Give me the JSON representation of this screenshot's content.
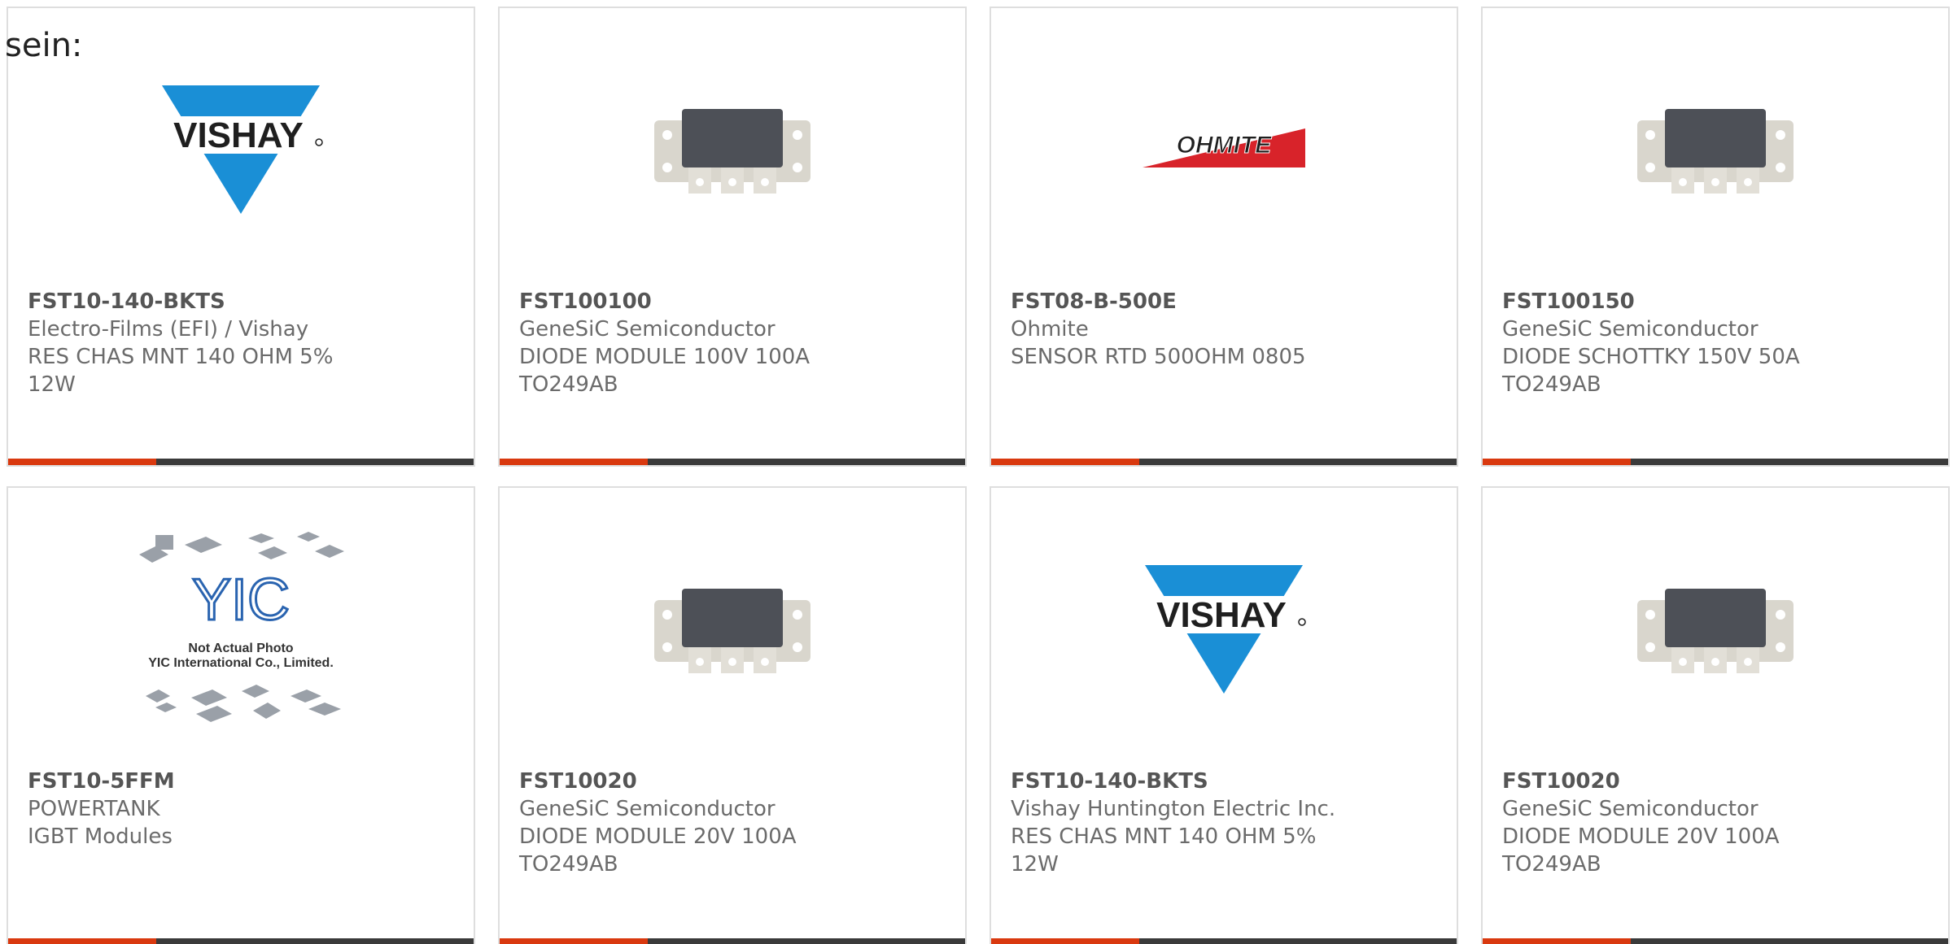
{
  "prefix_text": "sein:",
  "cards": [
    {
      "image": "vishay-logo",
      "part": "FST10-140-BKTS",
      "manufacturer": "Electro-Films (EFI) / Vishay",
      "description": "RES CHAS MNT 140 OHM 5% 12W"
    },
    {
      "image": "diode-module-photo",
      "part": "FST100100",
      "manufacturer": "GeneSiC Semiconductor",
      "description": "DIODE MODULE 100V 100A TO249AB"
    },
    {
      "image": "ohmite-logo",
      "part": "FST08-B-500E",
      "manufacturer": "Ohmite",
      "description": "SENSOR RTD 500OHM 0805"
    },
    {
      "image": "diode-module-photo",
      "part": "FST100150",
      "manufacturer": "GeneSiC Semiconductor",
      "description": "DIODE SCHOTTKY 150V 50A TO249AB"
    },
    {
      "image": "yic-placeholder",
      "part": "FST10-5FFM",
      "manufacturer": "POWERTANK",
      "description": "IGBT Modules",
      "image_caption_1": "Not Actual Photo",
      "image_caption_2": "YIC International Co., Limited.",
      "image_logo_text": "YIC"
    },
    {
      "image": "diode-module-photo",
      "part": "FST10020",
      "manufacturer": "GeneSiC Semiconductor",
      "description": "DIODE MODULE 20V 100A TO249AB"
    },
    {
      "image": "vishay-logo",
      "part": "FST10-140-BKTS",
      "manufacturer": "Vishay Huntington Electric Inc.",
      "description": "RES CHAS MNT 140 OHM 5% 12W"
    },
    {
      "image": "diode-module-photo",
      "part": "FST10020",
      "manufacturer": "GeneSiC Semiconductor",
      "description": "DIODE MODULE 20V 100A TO249AB"
    }
  ],
  "logos": {
    "vishay": "VISHAY",
    "ohmite": "OHMITE"
  },
  "colors": {
    "accent": "#d9390f",
    "bar": "#3a3a3a",
    "vishay_blue": "#1a8fd6",
    "ohmite_red": "#d8232a",
    "text": "#6b6b6b"
  }
}
